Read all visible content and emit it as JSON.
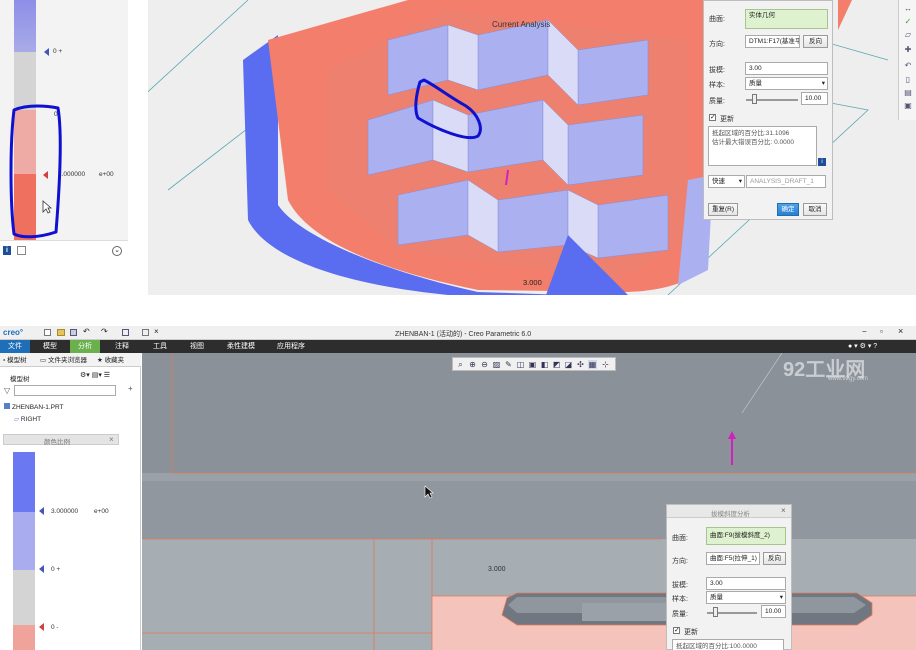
{
  "top": {
    "canvas_label": "Current Analysis",
    "dim_value": "3.000",
    "scale": {
      "label_zero_plus": "0 +",
      "label_zero": "0",
      "label_value": "1.000000",
      "label_exp": "e+00"
    },
    "dialog": {
      "surface_label": "曲面:",
      "surface_value": "实体几何",
      "direction_label": "方向:",
      "direction_value": "DTM1:F17(基准平",
      "flip_button": "反向",
      "draft_label": "拔模:",
      "draft_value": "3.00",
      "sample_label": "样本:",
      "sample_value": "质量",
      "quality_label": "质量:",
      "quality_value": "10.00",
      "update_label": "更新",
      "result_line1": "抵起区域的百分比:31.1096",
      "result_line2": "估计最大错误百分比: 0.0000",
      "mode_value": "快速",
      "analysis_name": "ANALYSIS_DRAFT_1",
      "repeat_button": "重复(R)",
      "ok_button": "确定",
      "cancel_button": "取消"
    }
  },
  "bottom": {
    "window_title": "ZHENBAN-1 (活动的) - Creo Parametric 6.0",
    "app_logo": "creo°",
    "menu": [
      "文件",
      "模型",
      "分析",
      "注释",
      "工具",
      "视图",
      "柔性建模",
      "应用程序"
    ],
    "active_menu_index": 2,
    "panel_tabs": [
      "模型树",
      "文件夹浏览器",
      "收藏夹"
    ],
    "tree_header": "模型树",
    "tree_items": [
      "ZHENBAN-1.PRT",
      "RIGHT"
    ],
    "color_scale_title": "颜色比例",
    "scale": {
      "label_value": "3.000000",
      "label_exp": "e+00",
      "label_zero_plus": "0 +",
      "label_zero_minus": "0 -"
    },
    "dim_value": "3.000",
    "watermark": "92工业网",
    "watermark_url": "www.92gy.com",
    "dialog": {
      "title": "拔模斜度分析",
      "surface_label": "曲面:",
      "surface_value": "曲面:F9(拔模斜度_2)",
      "direction_label": "方向:",
      "direction_value": "曲面:F5(拉伸_1)",
      "flip_button": "反向",
      "draft_label": "拔模:",
      "draft_value": "3.00",
      "sample_label": "样本:",
      "sample_value": "质量",
      "quality_label": "质量:",
      "quality_value": "10.00",
      "update_label": "更新",
      "result_line1": "抵起区域的百分比:100.0000"
    }
  },
  "colors": {
    "salmon": "#f47e6c",
    "blue_face": "#aab0f0",
    "blue_dark": "#5a6cf0",
    "annotation_blue": "#1010d0",
    "creo_green": "#6ab04c",
    "menubar": "#2d2d2d",
    "canvas_gray": "#8a9199"
  }
}
